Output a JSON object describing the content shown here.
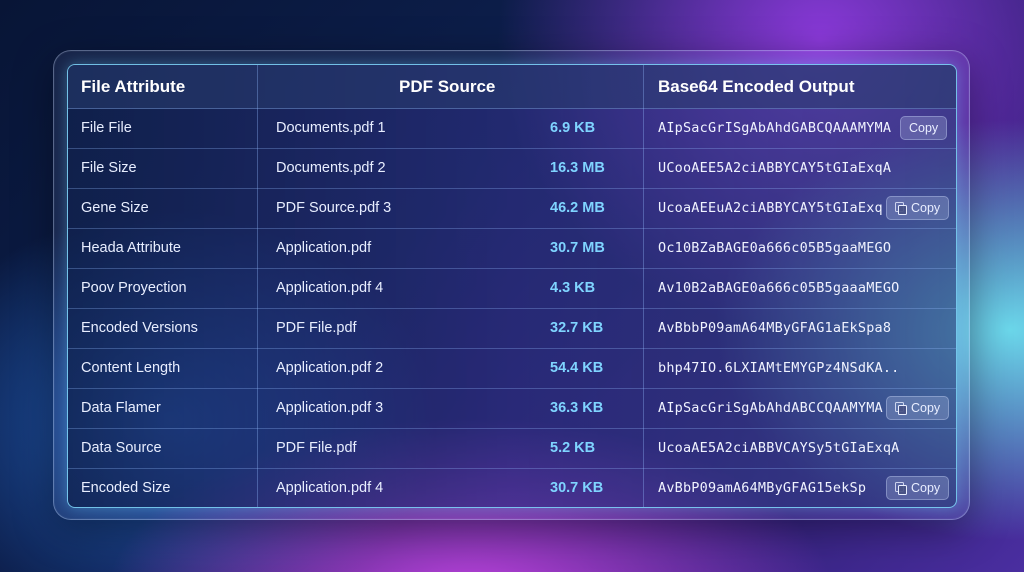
{
  "table": {
    "headers": [
      "File Attribute",
      "PDF Source",
      "Base64 Encoded Output"
    ],
    "copy_label": "Copy",
    "rows": [
      {
        "attribute": "File File",
        "file": "Documents.pdf 1",
        "size": "6.9 KB",
        "encoded": "AIpSacGrISgAbAhdGABCQAAAMYMA",
        "copy": true,
        "copy_icon": false
      },
      {
        "attribute": "File Size",
        "file": "Documents.pdf 2",
        "size": "16.3 MB",
        "encoded": "UCooAEE5A2ciABBYCAY5tGIaExqA",
        "copy": false,
        "copy_icon": false
      },
      {
        "attribute": "Gene Size",
        "file": "PDF Source.pdf 3",
        "size": "46.2 MB",
        "encoded": "UcoaAEEuA2ciABBYCAY5tGIaExq",
        "copy": true,
        "copy_icon": true
      },
      {
        "attribute": "Heada Attribute",
        "file": "Application.pdf",
        "size": "30.7 MB",
        "encoded": "Oc10BZaBAGE0a666c05B5gaaMEGO",
        "copy": false,
        "copy_icon": false
      },
      {
        "attribute": "Poov Proyection",
        "file": "Application.pdf 4",
        "size": "4.3 KB",
        "encoded": "Av10B2aBAGE0a666c05B5gaaaMEGO",
        "copy": false,
        "copy_icon": false
      },
      {
        "attribute": "Encoded Versions",
        "file": "PDF File.pdf",
        "size": "32.7 KB",
        "encoded": "AvBbbP09amA64MByGFAG1aEkSpa8",
        "copy": false,
        "copy_icon": false
      },
      {
        "attribute": "Content Length",
        "file": "Application.pdf 2",
        "size": "54.4 KB",
        "encoded": "bhp47IO.6LXIAMtEMYGPz4NSdKA..",
        "copy": false,
        "copy_icon": false
      },
      {
        "attribute": "Data Flamer",
        "file": "Application.pdf 3",
        "size": "36.3 KB",
        "encoded": "AIpSacGriSgAbAhdABCCQAAMYMA",
        "copy": true,
        "copy_icon": true
      },
      {
        "attribute": "Data Source",
        "file": "PDF File.pdf",
        "size": "5.2 KB",
        "encoded": "UcoaAE5A2ciABBVCAYSy5tGIaExqA",
        "copy": false,
        "copy_icon": false
      },
      {
        "attribute": "Encoded Size",
        "file": "Application.pdf 4",
        "size": "30.7 KB",
        "encoded": "AvBbP09amA64MByGFAG15ekSp",
        "copy": true,
        "copy_icon": true
      }
    ]
  },
  "colors": {
    "accent_size": "#7fd4ff",
    "table_border": "#82dcff"
  }
}
